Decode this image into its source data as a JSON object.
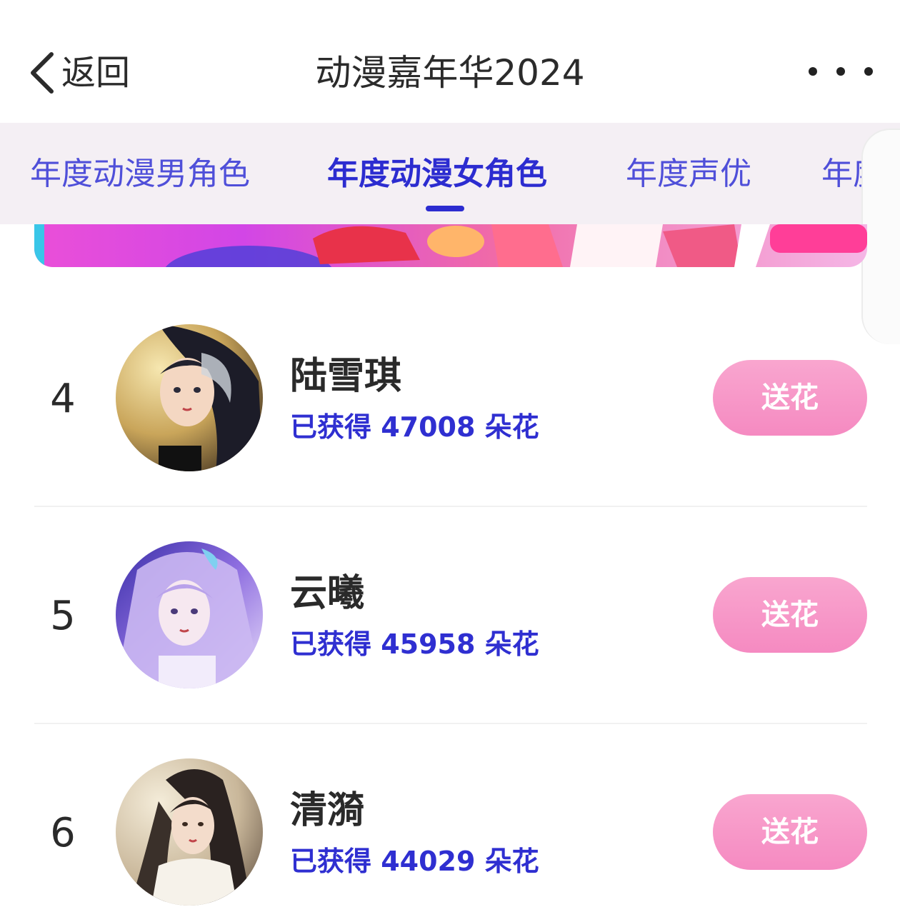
{
  "header": {
    "back_label": "返回",
    "title": "动漫嘉年华2024"
  },
  "tabs": [
    {
      "label": "年度动漫男角色",
      "active": false
    },
    {
      "label": "年度动漫女角色",
      "active": true
    },
    {
      "label": "年度声优",
      "active": false
    },
    {
      "label": "年度漫",
      "active": false
    }
  ],
  "list": [
    {
      "rank": "4",
      "name": "陆雪琪",
      "count_text": "已获得 47008 朵花",
      "button": "送花"
    },
    {
      "rank": "5",
      "name": "云曦",
      "count_text": "已获得 45958 朵花",
      "button": "送花"
    },
    {
      "rank": "6",
      "name": "清漪",
      "count_text": "已获得 44029 朵花",
      "button": "送花"
    }
  ],
  "colors": {
    "accent": "#2c2cd0",
    "button_pink": "#f58ac1",
    "tab_bg": "#f4eff4"
  }
}
